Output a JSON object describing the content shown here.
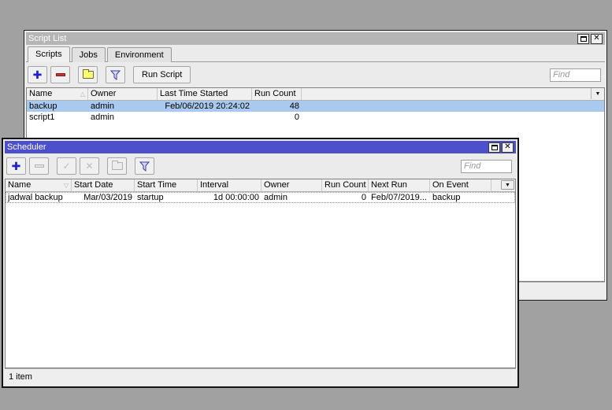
{
  "colors": {
    "desktop_bg": "#a1a1a1",
    "active_titlebar": "#4c50ca",
    "inactive_titlebar": "#b5b5b5",
    "selected_row": "#a9c9ef",
    "plus_icon_blue": "#2020c8",
    "minus_icon_red": "#c83030",
    "folder_icon_yellow": "#ffff73"
  },
  "icons": {
    "plus": "✚",
    "check": "✓",
    "cross": "✕",
    "close": "✕",
    "dropdown": "▼",
    "sort_asc": "△",
    "sort_desc": "▽"
  },
  "script_list": {
    "title": "Script List",
    "tabs": [
      {
        "label": "Scripts",
        "active": true
      },
      {
        "label": "Jobs",
        "active": false
      },
      {
        "label": "Environment",
        "active": false
      }
    ],
    "toolbar": {
      "run_script": "Run Script"
    },
    "find_placeholder": "Find",
    "table": {
      "columns": [
        "Name",
        "Owner",
        "Last Time Started",
        "Run Count"
      ],
      "rows": [
        {
          "name": "backup",
          "owner": "admin",
          "last_time_started": "Feb/06/2019 20:24:02",
          "run_count": "48",
          "selected": true
        },
        {
          "name": "script1",
          "owner": "admin",
          "last_time_started": "",
          "run_count": "0",
          "selected": false
        }
      ]
    }
  },
  "scheduler": {
    "title": "Scheduler",
    "find_placeholder": "Find",
    "table": {
      "columns": [
        "Name",
        "Start Date",
        "Start Time",
        "Interval",
        "Owner",
        "Run Count",
        "Next Run",
        "On Event"
      ],
      "rows": [
        {
          "name": "jadwal backup",
          "start_date": "Mar/03/2019",
          "start_time": "startup",
          "interval": "1d 00:00:00",
          "owner": "admin",
          "run_count": "0",
          "next_run": "Feb/07/2019...",
          "on_event": "backup"
        }
      ]
    },
    "status": "1 item"
  }
}
